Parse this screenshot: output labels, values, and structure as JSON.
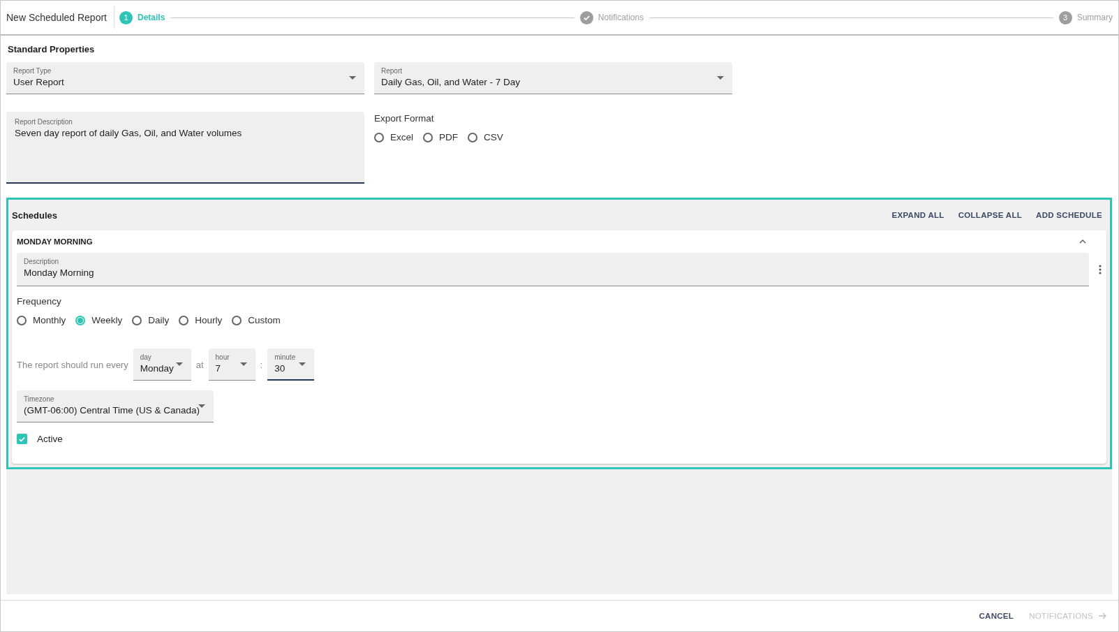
{
  "header": {
    "title": "New Scheduled Report"
  },
  "steps": [
    {
      "number": "1",
      "label": "Details",
      "selected": true,
      "completed": false
    },
    {
      "label": "Notifications",
      "selected": false,
      "completed": true
    },
    {
      "number": "3",
      "label": "Summary",
      "selected": false,
      "completed": false
    }
  ],
  "standard_properties": {
    "heading": "Standard Properties",
    "report_type": {
      "label": "Report Type",
      "value": "User Report"
    },
    "report": {
      "label": "Report",
      "value": "Daily Gas, Oil, and Water - 7 Day"
    },
    "description": {
      "label": "Report Description",
      "value": "Seven day report of daily Gas, Oil, and Water volumes",
      "focused": true
    },
    "export_format": {
      "label": "Export Format",
      "options": [
        {
          "label": "Excel",
          "selected": false
        },
        {
          "label": "PDF",
          "selected": false
        },
        {
          "label": "CSV",
          "selected": false
        }
      ]
    }
  },
  "schedules": {
    "heading": "Schedules",
    "actions": [
      "EXPAND ALL",
      "COLLAPSE ALL",
      "ADD SCHEDULE"
    ],
    "items": [
      {
        "title": "MONDAY MORNING",
        "expanded": true,
        "description": {
          "label": "Description",
          "value": "Monday Morning"
        },
        "frequency": {
          "label": "Frequency",
          "options": [
            {
              "label": "Monthly",
              "selected": false
            },
            {
              "label": "Weekly",
              "selected": true
            },
            {
              "label": "Daily",
              "selected": false
            },
            {
              "label": "Hourly",
              "selected": false
            },
            {
              "label": "Custom",
              "selected": false
            }
          ]
        },
        "run_text": "The report should run every",
        "at_text": "at",
        "colon_text": ":",
        "day": {
          "label": "day",
          "value": "Monday",
          "focused": false
        },
        "hour": {
          "label": "hour",
          "value": "7",
          "focused": false
        },
        "minute": {
          "label": "minute",
          "value": "30",
          "focused": true
        },
        "timezone": {
          "label": "Timezone",
          "value": "(GMT-06:00) Central Time (US & Canada)"
        },
        "active": {
          "label": "Active",
          "checked": true
        }
      }
    ]
  },
  "footer": {
    "cancel": "CANCEL",
    "next": {
      "label": "NOTIFICATIONS",
      "disabled": true
    }
  }
}
